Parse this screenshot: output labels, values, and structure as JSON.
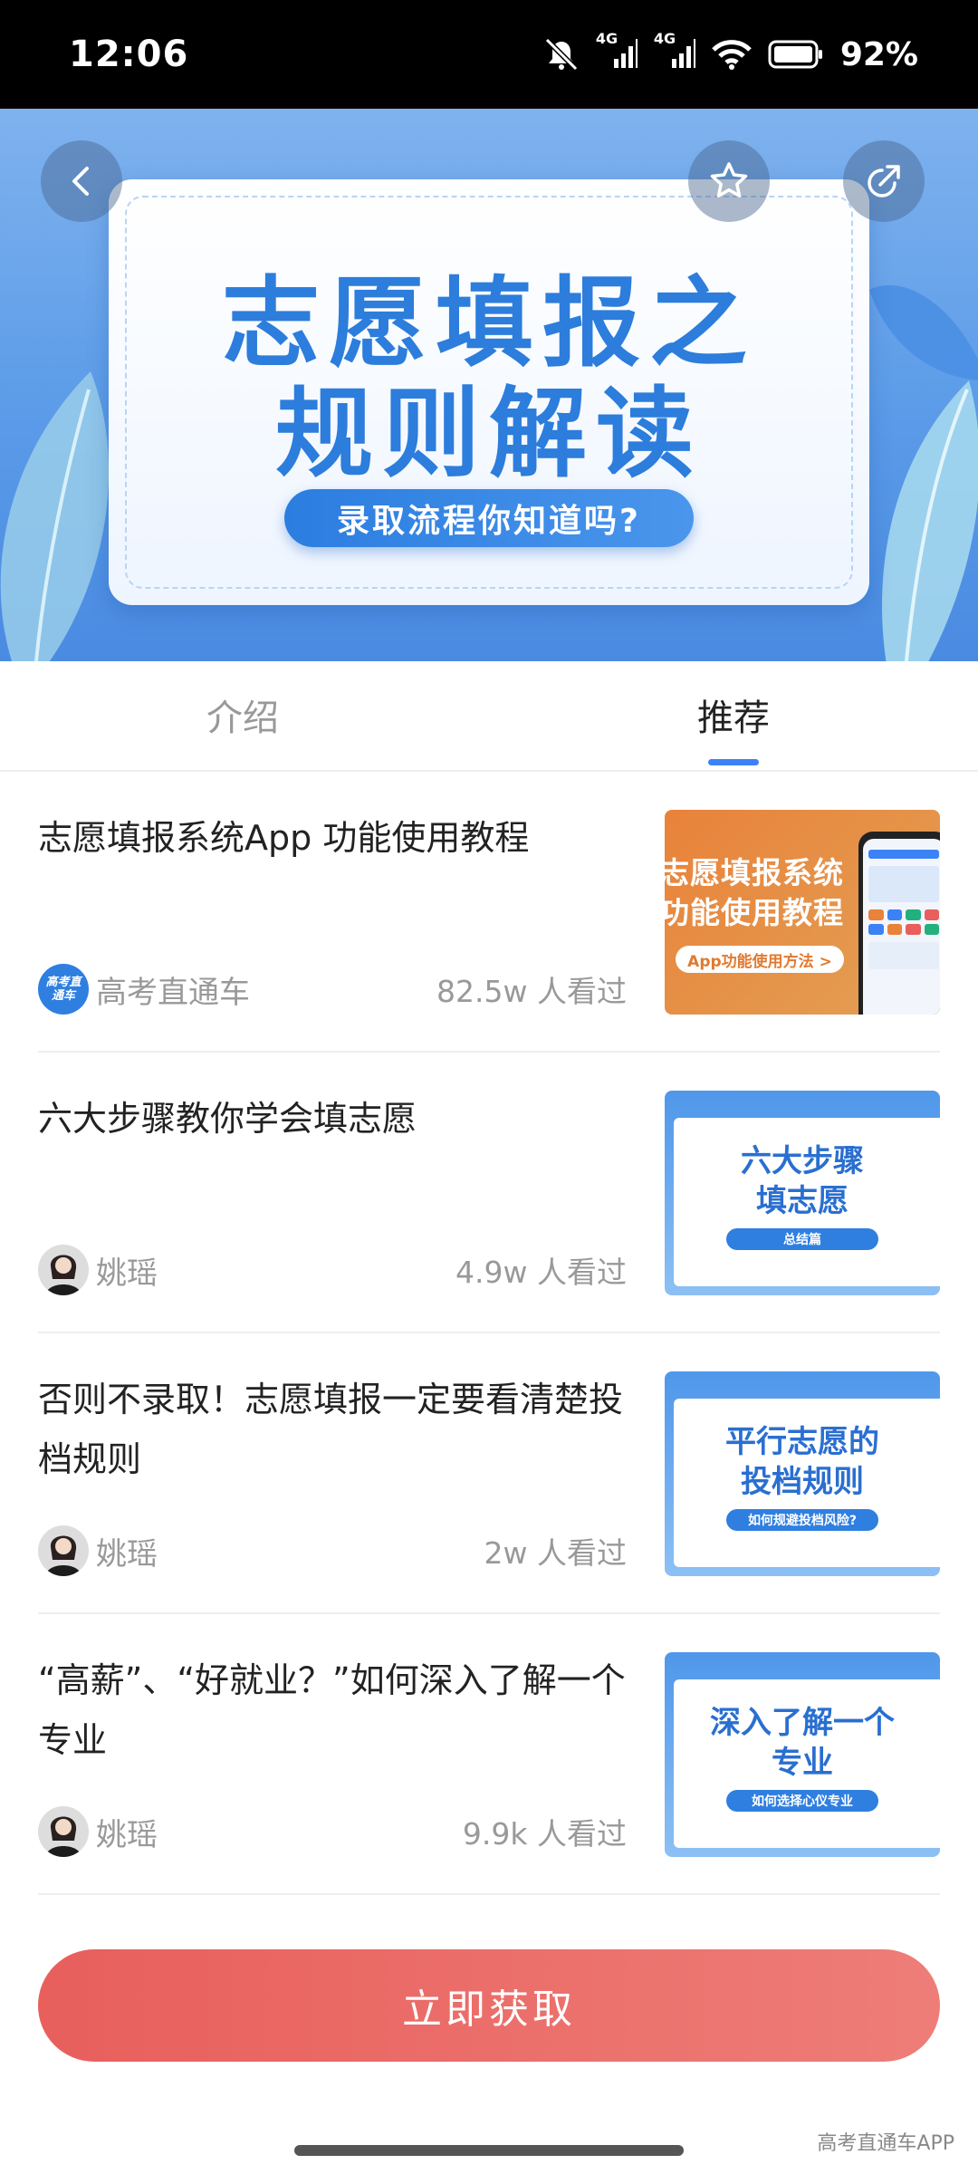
{
  "status_bar": {
    "time": "12:06",
    "battery": "92%",
    "net1": "4G",
    "net2": "4G"
  },
  "banner": {
    "title_line1": "志愿填报之",
    "title_line2": "规则解读",
    "pill": "录取流程你知道吗?"
  },
  "tabs": [
    {
      "label": "介绍",
      "active": false
    },
    {
      "label": "推荐",
      "active": true
    }
  ],
  "items": [
    {
      "title": "志愿填报系统App 功能使用教程",
      "author": "高考直通车",
      "author_badge": "高考直通车",
      "views": "82.5w 人看过",
      "thumb_line1": "志愿填报系统",
      "thumb_line2": "功能使用教程",
      "thumb_pill": "App功能使用方法 >"
    },
    {
      "title": "六大步骤教你学会填志愿",
      "author": "姚瑶",
      "views": "4.9w 人看过",
      "thumb_line1": "六大步骤",
      "thumb_line2": "填志愿",
      "thumb_pill": "总结篇"
    },
    {
      "title": "否则不录取！志愿填报一定要看清楚投档规则",
      "author": "姚瑶",
      "views": "2w 人看过",
      "thumb_line1": "平行志愿的",
      "thumb_line2": "投档规则",
      "thumb_pill": "如何规避投档风险?"
    },
    {
      "title": "“高薪”、“好就业？”如何深入了解一个专业",
      "author": "姚瑶",
      "views": "9.9k 人看过",
      "thumb_line1": "深入了解一个",
      "thumb_line2": "专业",
      "thumb_pill": "如何选择心仪专业"
    }
  ],
  "cta": {
    "label": "立即获取"
  },
  "watermark": "高考直通车APP",
  "colors": {
    "accent": "#3b82f6",
    "cta": "#e85f5c",
    "banner": "#5b9be8"
  }
}
